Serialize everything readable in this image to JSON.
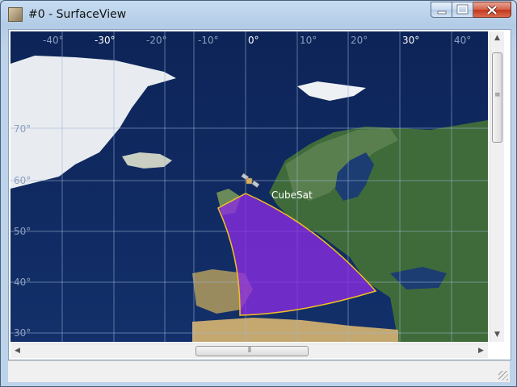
{
  "window": {
    "title": "#0 - SurfaceView",
    "buttons": {
      "minimize": "minimize-icon",
      "maximize": "maximize-icon",
      "close": "close-icon"
    }
  },
  "map": {
    "longitude_labels": [
      "-40°",
      "-30°",
      "-20°",
      "-10°",
      "0°",
      "10°",
      "20°",
      "30°",
      "40°"
    ],
    "latitude_labels": [
      "70°",
      "60°",
      "50°",
      "40°",
      "30°"
    ],
    "satellite": {
      "name": "CubeSat",
      "icon": "satellite-icon"
    },
    "coverage_color": "#8a2be2",
    "coverage_outline_color": "#f0c020"
  },
  "scrollbars": {
    "vertical": "vertical-scrollbar",
    "horizontal": "horizontal-scrollbar"
  }
}
